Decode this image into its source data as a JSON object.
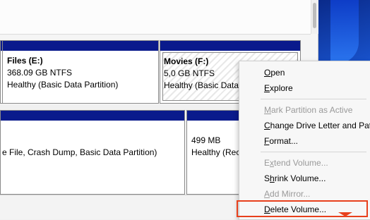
{
  "partitions": {
    "files": {
      "name": "Files  (E:)",
      "size": "368.09 GB NTFS",
      "status": "Healthy (Basic Data Partition)"
    },
    "movies": {
      "name": "Movies  (F:)",
      "size": "5,0  GB NTFS",
      "status": "Healthy (Basic Data Partition)"
    },
    "system": {
      "status": "e File, Crash Dump, Basic Data Partition)"
    },
    "recovery": {
      "size": "499 MB",
      "status": "Healthy (Rec"
    }
  },
  "context_menu": {
    "items": [
      {
        "label": "Open",
        "mnemonic": "O",
        "rest": "pen",
        "enabled": true
      },
      {
        "label": "Explore",
        "mnemonic": "E",
        "rest": "xplore",
        "enabled": true
      },
      {
        "label": "Mark Partition as Active",
        "mnemonic": "M",
        "rest": "ark Partition as Active",
        "enabled": false
      },
      {
        "label": "Change Drive Letter and Path",
        "mnemonic": "C",
        "rest": "hange Drive Letter and Path",
        "enabled": true
      },
      {
        "label": "Format...",
        "mnemonic": "F",
        "rest": "ormat...",
        "enabled": true
      },
      {
        "label": "Extend Volume...",
        "mnemonic": "x",
        "pre": "E",
        "rest": "tend Volume...",
        "enabled": false
      },
      {
        "label": "Shrink Volume...",
        "mnemonic": "h",
        "pre": "S",
        "rest": "rink Volume...",
        "enabled": true
      },
      {
        "label": "Add Mirror...",
        "mnemonic": "A",
        "rest": "dd Mirror...",
        "enabled": false
      },
      {
        "label": "Delete Volume...",
        "mnemonic": "D",
        "rest": "elete Volume...",
        "enabled": true,
        "highlighted": true
      }
    ]
  },
  "colors": {
    "header_bar": "#0a1a8c",
    "highlight_border": "#e8401c"
  }
}
